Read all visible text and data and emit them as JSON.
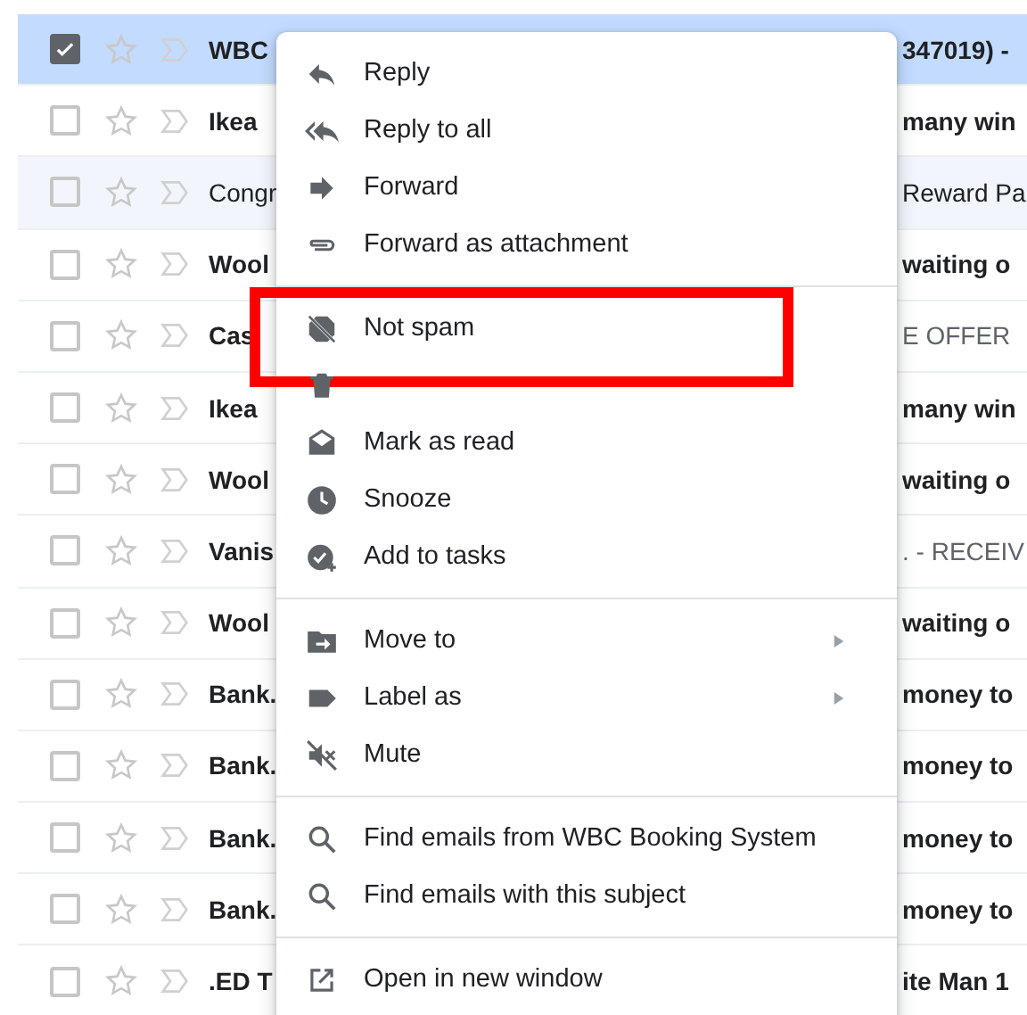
{
  "rows": [
    {
      "sender": "WBC",
      "tail": {
        "text": "347019) -",
        "kind": "subject"
      },
      "unread": true,
      "selected": true
    },
    {
      "sender": "Ikea",
      "tail": {
        "text": "many win",
        "kind": "subject"
      },
      "unread": true,
      "selected": false
    },
    {
      "sender": "Congr",
      "tail": {
        "text": "Reward Pa",
        "kind": "subject"
      },
      "unread": false,
      "selected": false
    },
    {
      "sender": "Wool",
      "tail": {
        "text": "waiting o",
        "kind": "subject"
      },
      "unread": true,
      "selected": false
    },
    {
      "sender": "Cas",
      "tail": {
        "text": "E OFFER",
        "kind": "snippet"
      },
      "unread": true,
      "selected": false
    },
    {
      "sender": "Ikea",
      "tail": {
        "text": "many win",
        "kind": "subject"
      },
      "unread": true,
      "selected": false
    },
    {
      "sender": "Wool",
      "tail": {
        "text": "waiting o",
        "kind": "subject"
      },
      "unread": true,
      "selected": false
    },
    {
      "sender": "Vanis",
      "tail": {
        "text": ". - RECEIV",
        "kind": "snippet"
      },
      "unread": true,
      "selected": false
    },
    {
      "sender": "Wool",
      "tail": {
        "text": "waiting o",
        "kind": "subject"
      },
      "unread": true,
      "selected": false
    },
    {
      "sender": "Bank.",
      "tail": {
        "text": "money to",
        "kind": "subject"
      },
      "unread": true,
      "selected": false
    },
    {
      "sender": "Bank.",
      "tail": {
        "text": "money to",
        "kind": "subject"
      },
      "unread": true,
      "selected": false
    },
    {
      "sender": "Bank.",
      "tail": {
        "text": "money to",
        "kind": "subject"
      },
      "unread": true,
      "selected": false
    },
    {
      "sender": "Bank.",
      "tail": {
        "text": "money to",
        "kind": "subject"
      },
      "unread": true,
      "selected": false
    },
    {
      "sender": ".ED T",
      "tail": {
        "text": "ite Man 1",
        "kind": "subject"
      },
      "unread": true,
      "selected": false
    }
  ],
  "context_menu": {
    "groups": [
      {
        "items": [
          {
            "label": "Reply",
            "submenu": false,
            "highlighted": false
          },
          {
            "label": "Reply to all",
            "submenu": false,
            "highlighted": false
          },
          {
            "label": "Forward",
            "submenu": false,
            "highlighted": false
          },
          {
            "label": "Forward as attachment",
            "submenu": false,
            "highlighted": false
          }
        ]
      },
      {
        "items": [
          {
            "label": "Not spam",
            "submenu": false,
            "highlighted": true
          },
          {
            "submenu": false,
            "highlighted": false
          },
          {
            "label": "Mark as read",
            "submenu": false,
            "highlighted": false
          },
          {
            "label": "Snooze",
            "submenu": false,
            "highlighted": false
          },
          {
            "label": "Add to tasks",
            "submenu": false,
            "highlighted": false
          }
        ]
      },
      {
        "items": [
          {
            "label": "Move to",
            "submenu": true,
            "highlighted": false
          },
          {
            "label": "Label as",
            "submenu": true,
            "highlighted": false
          },
          {
            "label": "Mute",
            "submenu": false,
            "highlighted": false
          }
        ]
      },
      {
        "items": [
          {
            "label": "Find emails from WBC Booking System",
            "submenu": false,
            "highlighted": false
          },
          {
            "label": "Find emails with this subject",
            "submenu": false,
            "highlighted": false
          }
        ]
      },
      {
        "items": [
          {
            "label": "Open in new window",
            "submenu": false,
            "highlighted": false
          }
        ]
      }
    ]
  }
}
